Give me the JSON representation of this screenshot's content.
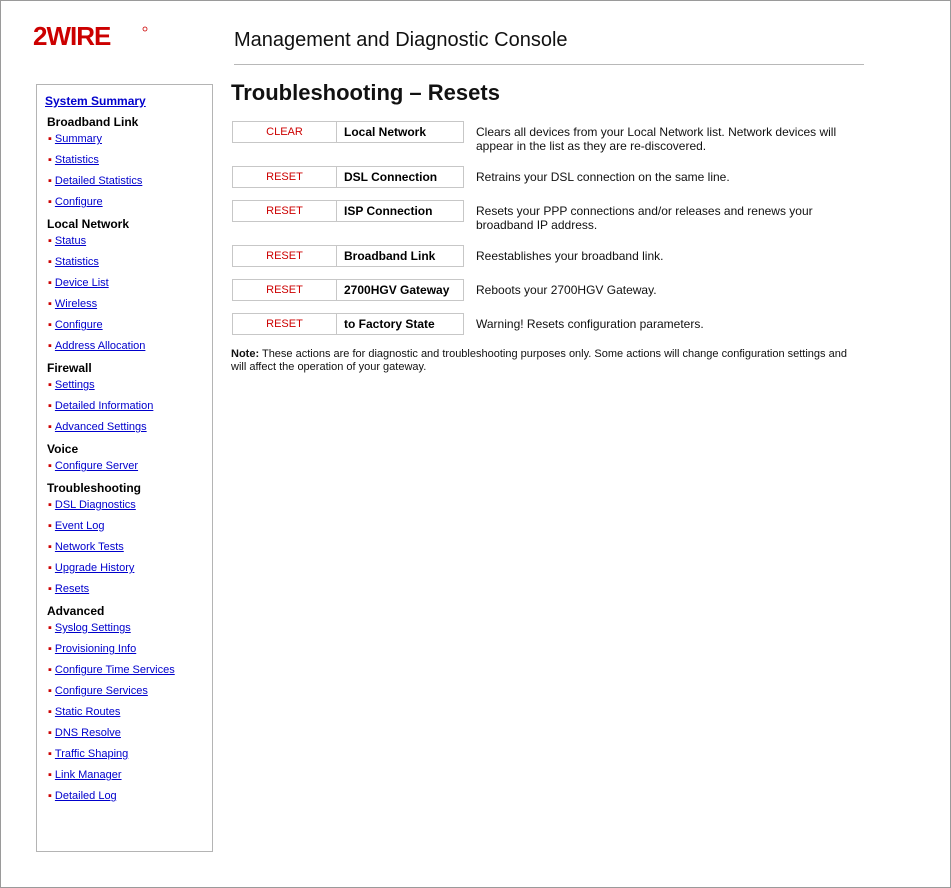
{
  "brand": {
    "logo_text": "2WIRE",
    "accent": "#cc0000"
  },
  "header": {
    "title": "Management and Diagnostic Console"
  },
  "sidebar": {
    "summary_link": "System Summary",
    "groups": [
      {
        "title": "Broadband Link",
        "items": [
          "Summary",
          "Statistics",
          "Detailed Statistics",
          "Configure"
        ]
      },
      {
        "title": "Local Network",
        "items": [
          "Status",
          "Statistics",
          "Device List",
          "Wireless",
          "Configure",
          "Address Allocation"
        ]
      },
      {
        "title": "Firewall",
        "items": [
          "Settings",
          "Detailed Information",
          "Advanced Settings"
        ]
      },
      {
        "title": "Voice",
        "items": [
          "Configure Server"
        ]
      },
      {
        "title": "Troubleshooting",
        "items": [
          "DSL Diagnostics",
          "Event Log",
          "Network Tests",
          "Upgrade History",
          "Resets"
        ]
      },
      {
        "title": "Advanced",
        "items": [
          "Syslog Settings",
          "Provisioning Info",
          "Configure Time Services",
          "Configure Services",
          "Static Routes",
          "DNS Resolve",
          "Traffic Shaping",
          "Link Manager",
          "Detailed Log"
        ]
      }
    ]
  },
  "main": {
    "title": "Troubleshooting – Resets",
    "actions": [
      {
        "button": "CLEAR",
        "name": "Local Network",
        "description": "Clears all devices from your Local Network list. Network devices will appear in the list as they are re-discovered."
      },
      {
        "button": "RESET",
        "name": "DSL Connection",
        "description": "Retrains your DSL connection on the same line."
      },
      {
        "button": "RESET",
        "name": "ISP Connection",
        "description": "Resets your PPP connections and/or releases and renews your broadband IP address."
      },
      {
        "button": "RESET",
        "name": "Broadband Link",
        "description": "Reestablishes your broadband link."
      },
      {
        "button": "RESET",
        "name": "2700HGV Gateway",
        "description": "Reboots your 2700HGV Gateway."
      },
      {
        "button": "RESET",
        "name": "to Factory State",
        "description": "Warning! Resets configuration parameters."
      }
    ],
    "note_label": "Note:",
    "note_text": "These actions are for diagnostic and troubleshooting purposes only. Some actions will change configuration settings and will affect the operation of your gateway."
  }
}
